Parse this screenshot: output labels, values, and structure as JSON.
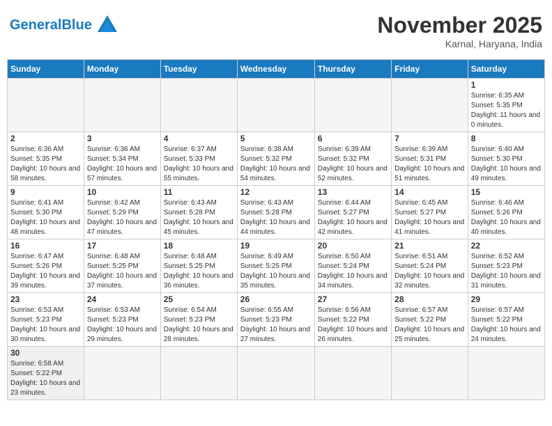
{
  "header": {
    "logo_general": "General",
    "logo_blue": "Blue",
    "month_title": "November 2025",
    "location": "Karnal, Haryana, India"
  },
  "weekdays": [
    "Sunday",
    "Monday",
    "Tuesday",
    "Wednesday",
    "Thursday",
    "Friday",
    "Saturday"
  ],
  "weeks": [
    [
      {
        "day": "",
        "info": ""
      },
      {
        "day": "",
        "info": ""
      },
      {
        "day": "",
        "info": ""
      },
      {
        "day": "",
        "info": ""
      },
      {
        "day": "",
        "info": ""
      },
      {
        "day": "",
        "info": ""
      },
      {
        "day": "1",
        "info": "Sunrise: 6:35 AM\nSunset: 5:35 PM\nDaylight: 11 hours and 0 minutes."
      }
    ],
    [
      {
        "day": "2",
        "info": "Sunrise: 6:36 AM\nSunset: 5:35 PM\nDaylight: 10 hours and 58 minutes."
      },
      {
        "day": "3",
        "info": "Sunrise: 6:36 AM\nSunset: 5:34 PM\nDaylight: 10 hours and 57 minutes."
      },
      {
        "day": "4",
        "info": "Sunrise: 6:37 AM\nSunset: 5:33 PM\nDaylight: 10 hours and 55 minutes."
      },
      {
        "day": "5",
        "info": "Sunrise: 6:38 AM\nSunset: 5:32 PM\nDaylight: 10 hours and 54 minutes."
      },
      {
        "day": "6",
        "info": "Sunrise: 6:39 AM\nSunset: 5:32 PM\nDaylight: 10 hours and 52 minutes."
      },
      {
        "day": "7",
        "info": "Sunrise: 6:39 AM\nSunset: 5:31 PM\nDaylight: 10 hours and 51 minutes."
      },
      {
        "day": "8",
        "info": "Sunrise: 6:40 AM\nSunset: 5:30 PM\nDaylight: 10 hours and 49 minutes."
      }
    ],
    [
      {
        "day": "9",
        "info": "Sunrise: 6:41 AM\nSunset: 5:30 PM\nDaylight: 10 hours and 48 minutes."
      },
      {
        "day": "10",
        "info": "Sunrise: 6:42 AM\nSunset: 5:29 PM\nDaylight: 10 hours and 47 minutes."
      },
      {
        "day": "11",
        "info": "Sunrise: 6:43 AM\nSunset: 5:28 PM\nDaylight: 10 hours and 45 minutes."
      },
      {
        "day": "12",
        "info": "Sunrise: 6:43 AM\nSunset: 5:28 PM\nDaylight: 10 hours and 44 minutes."
      },
      {
        "day": "13",
        "info": "Sunrise: 6:44 AM\nSunset: 5:27 PM\nDaylight: 10 hours and 42 minutes."
      },
      {
        "day": "14",
        "info": "Sunrise: 6:45 AM\nSunset: 5:27 PM\nDaylight: 10 hours and 41 minutes."
      },
      {
        "day": "15",
        "info": "Sunrise: 6:46 AM\nSunset: 5:26 PM\nDaylight: 10 hours and 40 minutes."
      }
    ],
    [
      {
        "day": "16",
        "info": "Sunrise: 6:47 AM\nSunset: 5:26 PM\nDaylight: 10 hours and 39 minutes."
      },
      {
        "day": "17",
        "info": "Sunrise: 6:48 AM\nSunset: 5:25 PM\nDaylight: 10 hours and 37 minutes."
      },
      {
        "day": "18",
        "info": "Sunrise: 6:48 AM\nSunset: 5:25 PM\nDaylight: 10 hours and 36 minutes."
      },
      {
        "day": "19",
        "info": "Sunrise: 6:49 AM\nSunset: 5:25 PM\nDaylight: 10 hours and 35 minutes."
      },
      {
        "day": "20",
        "info": "Sunrise: 6:50 AM\nSunset: 5:24 PM\nDaylight: 10 hours and 34 minutes."
      },
      {
        "day": "21",
        "info": "Sunrise: 6:51 AM\nSunset: 5:24 PM\nDaylight: 10 hours and 32 minutes."
      },
      {
        "day": "22",
        "info": "Sunrise: 6:52 AM\nSunset: 5:23 PM\nDaylight: 10 hours and 31 minutes."
      }
    ],
    [
      {
        "day": "23",
        "info": "Sunrise: 6:53 AM\nSunset: 5:23 PM\nDaylight: 10 hours and 30 minutes."
      },
      {
        "day": "24",
        "info": "Sunrise: 6:53 AM\nSunset: 5:23 PM\nDaylight: 10 hours and 29 minutes."
      },
      {
        "day": "25",
        "info": "Sunrise: 6:54 AM\nSunset: 5:23 PM\nDaylight: 10 hours and 28 minutes."
      },
      {
        "day": "26",
        "info": "Sunrise: 6:55 AM\nSunset: 5:23 PM\nDaylight: 10 hours and 27 minutes."
      },
      {
        "day": "27",
        "info": "Sunrise: 6:56 AM\nSunset: 5:22 PM\nDaylight: 10 hours and 26 minutes."
      },
      {
        "day": "28",
        "info": "Sunrise: 6:57 AM\nSunset: 5:22 PM\nDaylight: 10 hours and 25 minutes."
      },
      {
        "day": "29",
        "info": "Sunrise: 6:57 AM\nSunset: 5:22 PM\nDaylight: 10 hours and 24 minutes."
      }
    ],
    [
      {
        "day": "30",
        "info": "Sunrise: 6:58 AM\nSunset: 5:22 PM\nDaylight: 10 hours and 23 minutes."
      },
      {
        "day": "",
        "info": ""
      },
      {
        "day": "",
        "info": ""
      },
      {
        "day": "",
        "info": ""
      },
      {
        "day": "",
        "info": ""
      },
      {
        "day": "",
        "info": ""
      },
      {
        "day": "",
        "info": ""
      }
    ]
  ]
}
